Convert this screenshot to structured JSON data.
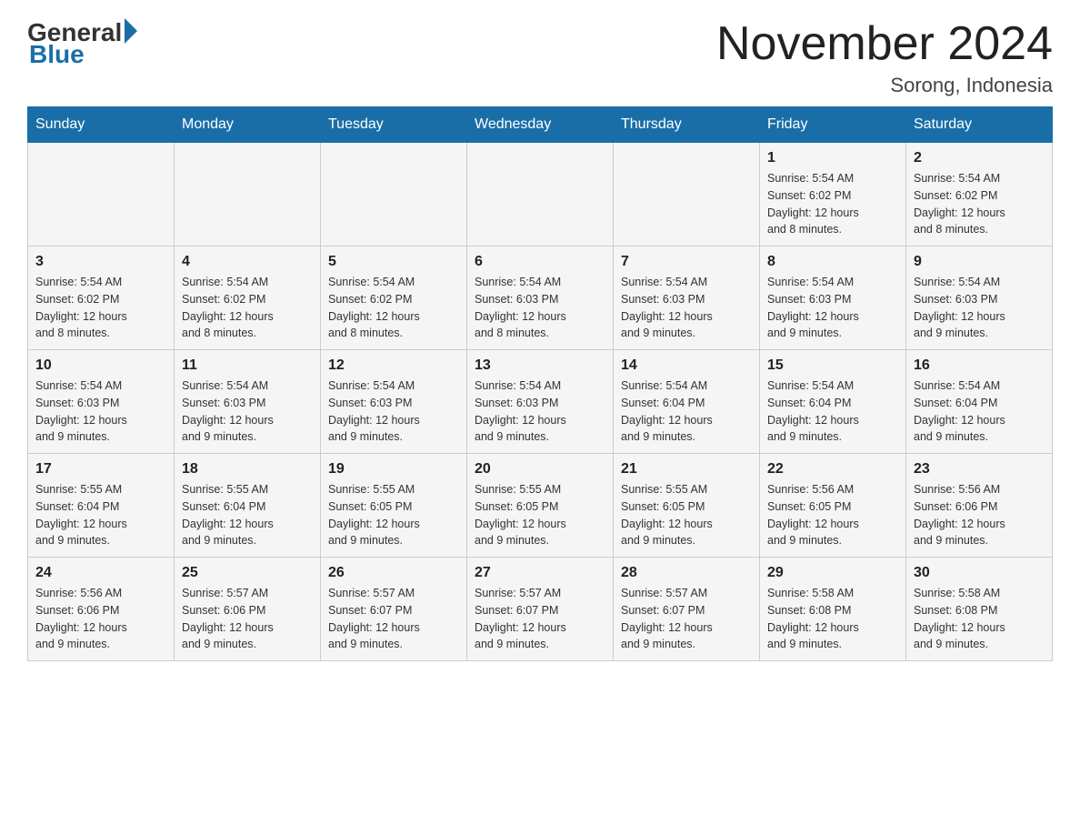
{
  "header": {
    "logo_general": "General",
    "logo_blue": "Blue",
    "month_year": "November 2024",
    "location": "Sorong, Indonesia"
  },
  "days_of_week": [
    "Sunday",
    "Monday",
    "Tuesday",
    "Wednesday",
    "Thursday",
    "Friday",
    "Saturday"
  ],
  "weeks": [
    {
      "days": [
        {
          "num": "",
          "info": ""
        },
        {
          "num": "",
          "info": ""
        },
        {
          "num": "",
          "info": ""
        },
        {
          "num": "",
          "info": ""
        },
        {
          "num": "",
          "info": ""
        },
        {
          "num": "1",
          "info": "Sunrise: 5:54 AM\nSunset: 6:02 PM\nDaylight: 12 hours\nand 8 minutes."
        },
        {
          "num": "2",
          "info": "Sunrise: 5:54 AM\nSunset: 6:02 PM\nDaylight: 12 hours\nand 8 minutes."
        }
      ]
    },
    {
      "days": [
        {
          "num": "3",
          "info": "Sunrise: 5:54 AM\nSunset: 6:02 PM\nDaylight: 12 hours\nand 8 minutes."
        },
        {
          "num": "4",
          "info": "Sunrise: 5:54 AM\nSunset: 6:02 PM\nDaylight: 12 hours\nand 8 minutes."
        },
        {
          "num": "5",
          "info": "Sunrise: 5:54 AM\nSunset: 6:02 PM\nDaylight: 12 hours\nand 8 minutes."
        },
        {
          "num": "6",
          "info": "Sunrise: 5:54 AM\nSunset: 6:03 PM\nDaylight: 12 hours\nand 8 minutes."
        },
        {
          "num": "7",
          "info": "Sunrise: 5:54 AM\nSunset: 6:03 PM\nDaylight: 12 hours\nand 9 minutes."
        },
        {
          "num": "8",
          "info": "Sunrise: 5:54 AM\nSunset: 6:03 PM\nDaylight: 12 hours\nand 9 minutes."
        },
        {
          "num": "9",
          "info": "Sunrise: 5:54 AM\nSunset: 6:03 PM\nDaylight: 12 hours\nand 9 minutes."
        }
      ]
    },
    {
      "days": [
        {
          "num": "10",
          "info": "Sunrise: 5:54 AM\nSunset: 6:03 PM\nDaylight: 12 hours\nand 9 minutes."
        },
        {
          "num": "11",
          "info": "Sunrise: 5:54 AM\nSunset: 6:03 PM\nDaylight: 12 hours\nand 9 minutes."
        },
        {
          "num": "12",
          "info": "Sunrise: 5:54 AM\nSunset: 6:03 PM\nDaylight: 12 hours\nand 9 minutes."
        },
        {
          "num": "13",
          "info": "Sunrise: 5:54 AM\nSunset: 6:03 PM\nDaylight: 12 hours\nand 9 minutes."
        },
        {
          "num": "14",
          "info": "Sunrise: 5:54 AM\nSunset: 6:04 PM\nDaylight: 12 hours\nand 9 minutes."
        },
        {
          "num": "15",
          "info": "Sunrise: 5:54 AM\nSunset: 6:04 PM\nDaylight: 12 hours\nand 9 minutes."
        },
        {
          "num": "16",
          "info": "Sunrise: 5:54 AM\nSunset: 6:04 PM\nDaylight: 12 hours\nand 9 minutes."
        }
      ]
    },
    {
      "days": [
        {
          "num": "17",
          "info": "Sunrise: 5:55 AM\nSunset: 6:04 PM\nDaylight: 12 hours\nand 9 minutes."
        },
        {
          "num": "18",
          "info": "Sunrise: 5:55 AM\nSunset: 6:04 PM\nDaylight: 12 hours\nand 9 minutes."
        },
        {
          "num": "19",
          "info": "Sunrise: 5:55 AM\nSunset: 6:05 PM\nDaylight: 12 hours\nand 9 minutes."
        },
        {
          "num": "20",
          "info": "Sunrise: 5:55 AM\nSunset: 6:05 PM\nDaylight: 12 hours\nand 9 minutes."
        },
        {
          "num": "21",
          "info": "Sunrise: 5:55 AM\nSunset: 6:05 PM\nDaylight: 12 hours\nand 9 minutes."
        },
        {
          "num": "22",
          "info": "Sunrise: 5:56 AM\nSunset: 6:05 PM\nDaylight: 12 hours\nand 9 minutes."
        },
        {
          "num": "23",
          "info": "Sunrise: 5:56 AM\nSunset: 6:06 PM\nDaylight: 12 hours\nand 9 minutes."
        }
      ]
    },
    {
      "days": [
        {
          "num": "24",
          "info": "Sunrise: 5:56 AM\nSunset: 6:06 PM\nDaylight: 12 hours\nand 9 minutes."
        },
        {
          "num": "25",
          "info": "Sunrise: 5:57 AM\nSunset: 6:06 PM\nDaylight: 12 hours\nand 9 minutes."
        },
        {
          "num": "26",
          "info": "Sunrise: 5:57 AM\nSunset: 6:07 PM\nDaylight: 12 hours\nand 9 minutes."
        },
        {
          "num": "27",
          "info": "Sunrise: 5:57 AM\nSunset: 6:07 PM\nDaylight: 12 hours\nand 9 minutes."
        },
        {
          "num": "28",
          "info": "Sunrise: 5:57 AM\nSunset: 6:07 PM\nDaylight: 12 hours\nand 9 minutes."
        },
        {
          "num": "29",
          "info": "Sunrise: 5:58 AM\nSunset: 6:08 PM\nDaylight: 12 hours\nand 9 minutes."
        },
        {
          "num": "30",
          "info": "Sunrise: 5:58 AM\nSunset: 6:08 PM\nDaylight: 12 hours\nand 9 minutes."
        }
      ]
    }
  ]
}
